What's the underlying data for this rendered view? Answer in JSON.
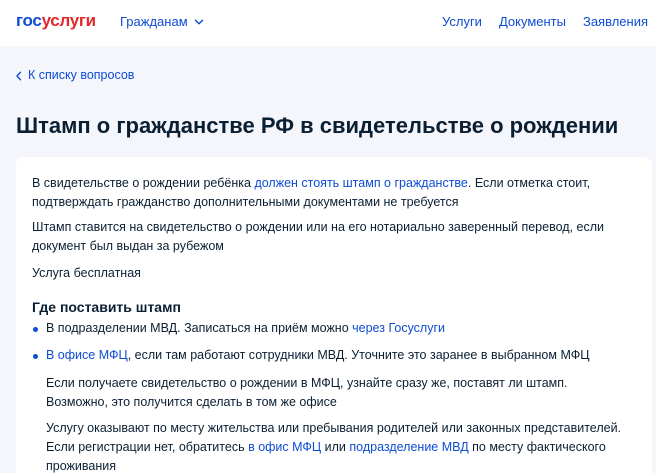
{
  "header": {
    "logo_part1": "гос",
    "logo_part2": "услуги",
    "audience_label": "Гражданам",
    "nav": [
      "Услуги",
      "Документы",
      "Заявления"
    ]
  },
  "back_link": "К списку вопросов",
  "page_title": "Штамп о гражданстве РФ в свидетельстве о рождении",
  "content": {
    "p1_before": "В свидетельстве о рождении ребёнка ",
    "p1_link": "должен стоять штамп о гражданстве",
    "p1_after": ". Если отметка стоит, подтверждать гражданство дополнительными документами не требуется",
    "p2": "Штамп ставится на свидетельство о рождении или на его нотариально заверенный перевод, если документ был выдан за рубежом",
    "p3": "Услуга бесплатная",
    "section_title": "Где поставить штамп",
    "b1_before": "В подразделении МВД. Записаться на приём можно ",
    "b1_link": "через Госуслуги",
    "b2_link": "В офисе МФЦ",
    "b2_after": ", если там работают сотрудники МВД. Уточните это заранее в выбранном МФЦ",
    "s1": "Если получаете свидетельство о рождении в МФЦ, узнайте сразу же, поставят ли штамп. Возможно, это получится сделать в том же офисе",
    "s2_before": "Услугу оказывают по месту жительства или пребывания родителей или законных представителей. Если регистрации нет, обратитесь ",
    "s2_link1": "в офис МФЦ",
    "s2_mid": " или ",
    "s2_link2": "подразделение МВД",
    "s2_after": " по месту фактического проживания"
  },
  "colors": {
    "link": "#0d4cd3",
    "logo_red": "#e3282b",
    "text": "#0b1f33",
    "background": "#f4f6fb"
  }
}
